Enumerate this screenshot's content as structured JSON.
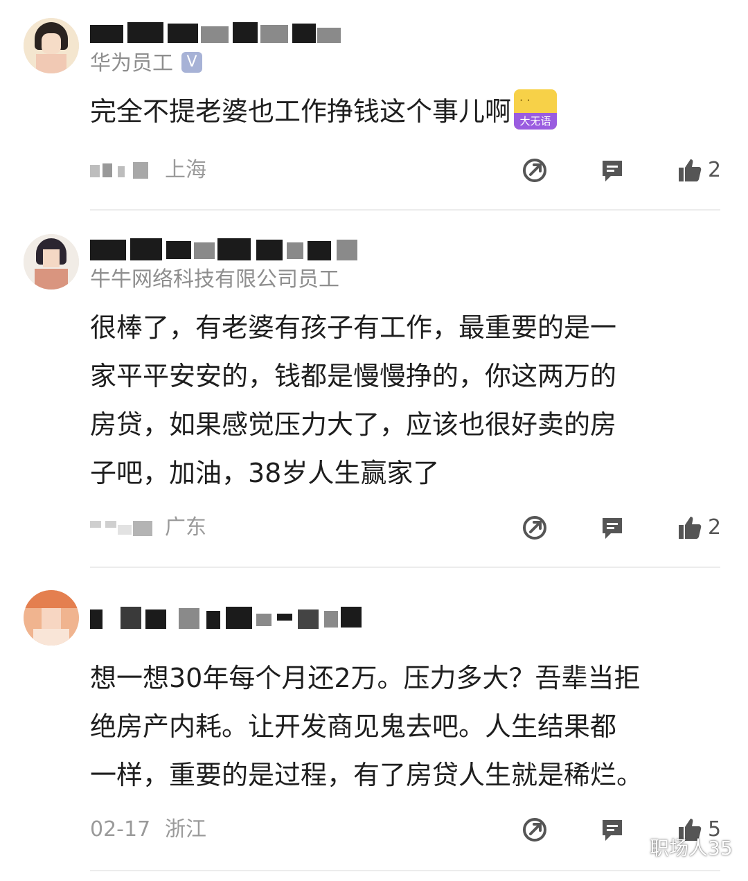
{
  "comments": [
    {
      "author_label": "华为员工",
      "verified_mark": "V",
      "text": "完全不提老婆也工作挣钱这个事儿啊",
      "emoji_face": "ᐧ ᐧ",
      "emoji_label": "大无语",
      "date": "",
      "location": "上海",
      "likes": "2"
    },
    {
      "author_label": "牛牛网络科技有限公司员工",
      "lines": [
        "很棒了，有老婆有孩子有工作，最重要的是一",
        "家平平安安的，钱都是慢慢挣的，你这两万的",
        "房贷，如果感觉压力大了，应该也很好卖的房",
        "子吧，加油，38岁人生赢家了"
      ],
      "date": "",
      "location": "广东",
      "likes": "2"
    },
    {
      "lines": [
        "想一想30年每个月还2万。压力多大？吾辈当拒",
        "绝房产内耗。让开发商见鬼去吧。人生结果都",
        "一样，重要的是过程，有了房贷人生就是稀烂。"
      ],
      "date": "02-17",
      "location": "浙江",
      "likes": "5"
    }
  ],
  "icons": {
    "share": "share-icon",
    "reply": "reply-icon",
    "like": "thumbs-up-icon"
  },
  "colors": {
    "text": "#1e1e1e",
    "meta": "#9a9a9a",
    "icon": "#555555",
    "divider": "#ececec"
  },
  "watermark": "职场人35"
}
